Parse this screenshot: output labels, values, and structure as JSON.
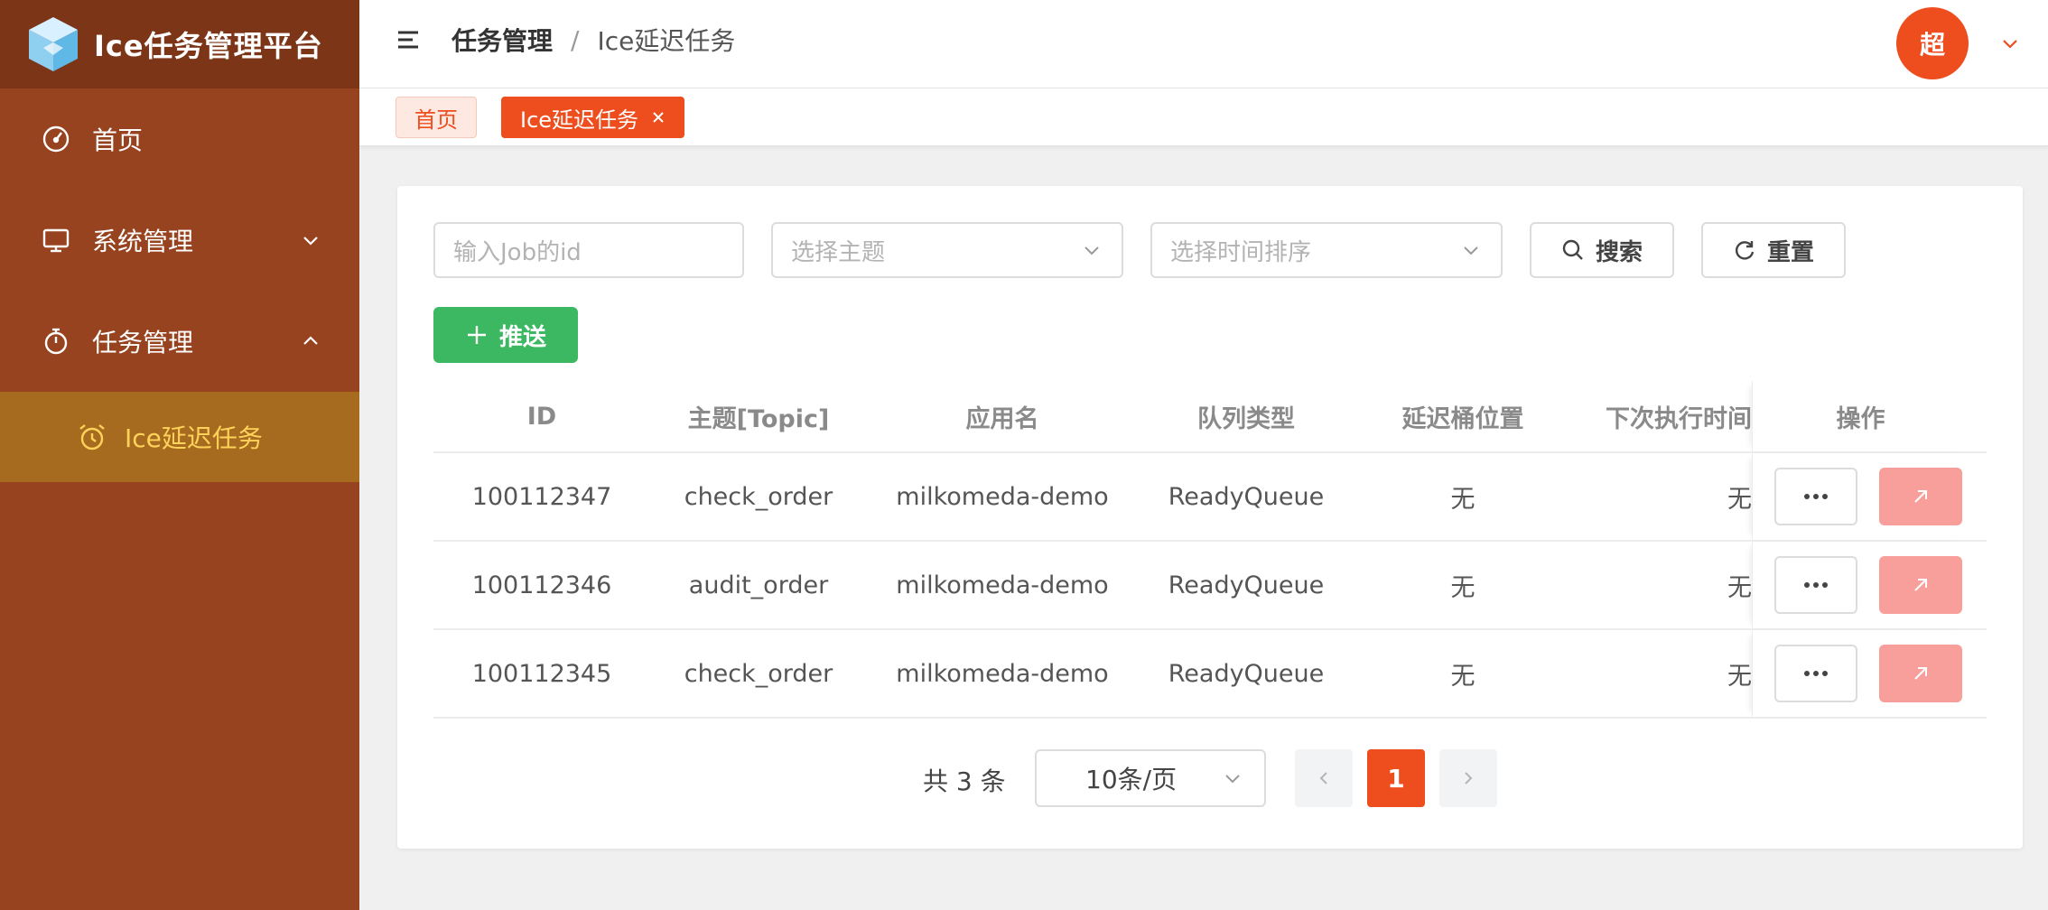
{
  "app": {
    "title": "Ice任务管理平台"
  },
  "sidebar": {
    "items": [
      {
        "label": "首页",
        "icon": "dashboard-icon"
      },
      {
        "label": "系统管理",
        "icon": "monitor-icon",
        "expanded": false
      },
      {
        "label": "任务管理",
        "icon": "timer-icon",
        "expanded": true
      },
      {
        "label": "Ice延迟任务",
        "icon": "alarm-clock-icon",
        "active": true
      }
    ]
  },
  "header": {
    "breadcrumb": [
      "任务管理",
      "Ice延迟任务"
    ],
    "separator": "/",
    "avatar_text": "超"
  },
  "tags": {
    "home": "首页",
    "active": "Ice延迟任务"
  },
  "filters": {
    "job_id_placeholder": "输入Job的id",
    "topic_placeholder": "选择主题",
    "sort_placeholder": "选择时间排序",
    "search_label": "搜索",
    "reset_label": "重置",
    "push_label": "推送"
  },
  "table": {
    "headers": [
      "ID",
      "主题[Topic]",
      "应用名",
      "队列类型",
      "延迟桶位置",
      "下次执行时间",
      "操作"
    ],
    "rows": [
      {
        "id": "100112347",
        "topic": "check_order",
        "app": "milkomeda-demo",
        "queue": "ReadyQueue",
        "bucket": "无",
        "next": "无"
      },
      {
        "id": "100112346",
        "topic": "audit_order",
        "app": "milkomeda-demo",
        "queue": "ReadyQueue",
        "bucket": "无",
        "next": "无"
      },
      {
        "id": "100112345",
        "topic": "check_order",
        "app": "milkomeda-demo",
        "queue": "ReadyQueue",
        "bucket": "无",
        "next": "无"
      }
    ]
  },
  "pagination": {
    "total_text": "共 3 条",
    "page_size": "10条/页",
    "current_page": "1"
  },
  "colors": {
    "sidebar_bg": "#97431f",
    "logo_bar_bg": "#7d3517",
    "submenu_active_bg": "#a66b1f",
    "submenu_active_text": "#ffd35a",
    "accent": "#ee4d1d",
    "push_button": "#3bb861",
    "jump_button": "#f89e9b"
  }
}
